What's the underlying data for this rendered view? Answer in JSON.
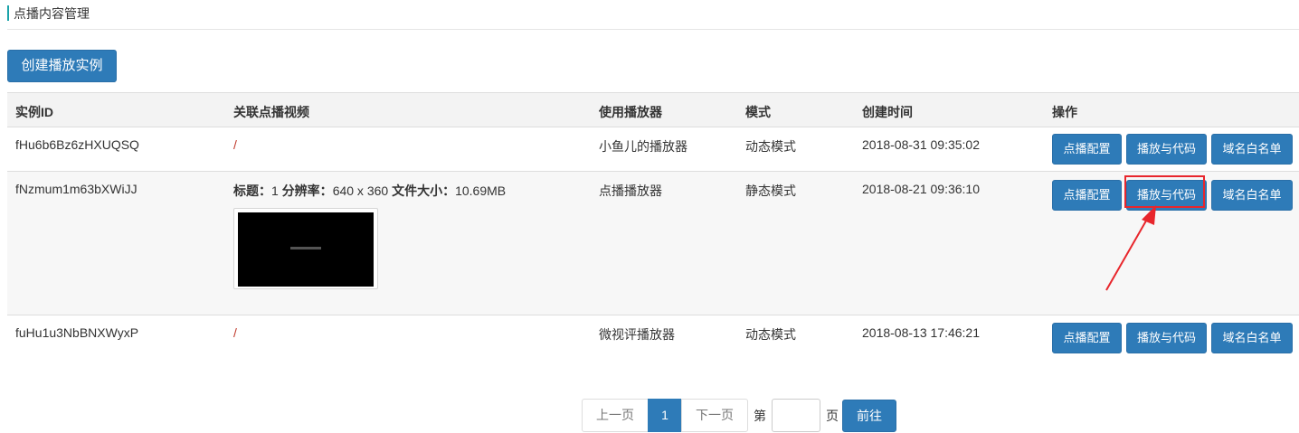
{
  "page_title": "点播内容管理",
  "create_button": "创建播放实例",
  "table": {
    "headers": [
      "实例ID",
      "关联点播视频",
      "使用播放器",
      "模式",
      "创建时间",
      "操作"
    ],
    "rows": [
      {
        "id": "fHu6b6Bz6zHXUQSQ",
        "video": "/",
        "player": "小鱼儿的播放器",
        "mode": "动态模式",
        "created": "2018-08-31 09:35:02"
      },
      {
        "id": "fNzmum1m63bXWiJJ",
        "video_info": {
          "title_label": "标题：",
          "title_value": "1",
          "resolution_label": "分辨率：",
          "resolution_value": "640 x 360",
          "size_label": "文件大小：",
          "size_value": "10.69MB"
        },
        "player": "点播播放器",
        "mode": "静态模式",
        "created": "2018-08-21 09:36:10"
      },
      {
        "id": "fuHu1u3NbBNXWyxP",
        "video": "/",
        "player": "微视评播放器",
        "mode": "动态模式",
        "created": "2018-08-13 17:46:21"
      }
    ],
    "actions": [
      "点播配置",
      "播放与代码",
      "域名白名单"
    ]
  },
  "pagination": {
    "prev": "上一页",
    "current": "1",
    "next": "下一页",
    "goto_prefix": "第",
    "goto_suffix": "页",
    "goto_value": "",
    "go_button": "前往"
  },
  "colors": {
    "primary": "#2e7bb8",
    "accent_bar": "#1aa3a9",
    "highlight": "#e8262c"
  }
}
